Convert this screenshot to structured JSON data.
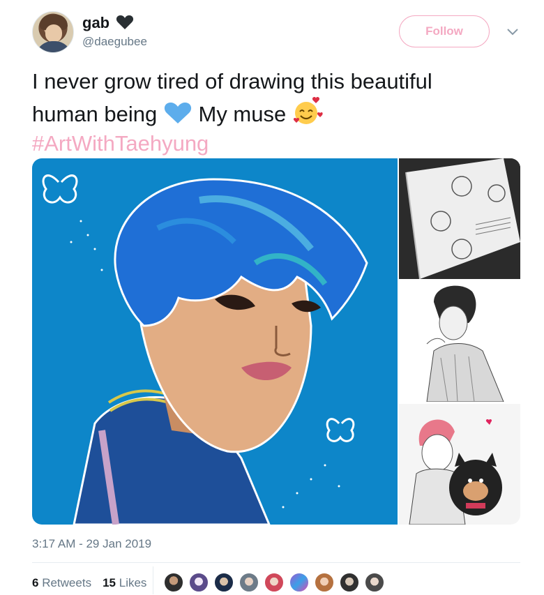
{
  "user": {
    "name": "gab",
    "handle": "@daegubee"
  },
  "follow_label": "Follow",
  "tweet": {
    "line1": "I never grow tired of drawing this beautiful",
    "line2_a": "human being",
    "line2_b": "My muse",
    "hashtag": "#ArtWithTaehyung"
  },
  "timestamp": "3:17 AM - 29 Jan 2019",
  "stats": {
    "retweets_count": "6",
    "retweets_label": "Retweets",
    "likes_count": "15",
    "likes_label": "Likes"
  },
  "icons": {
    "name_emoji": "black-heart-icon",
    "blue_heart": "blue-heart-icon",
    "smile_hearts": "smiling-face-with-hearts-icon",
    "more": "chevron-down-icon"
  },
  "colors": {
    "accent_pink": "#f4a9c2",
    "text": "#14171a",
    "muted": "#657786",
    "art_background": "#0d86c9"
  }
}
